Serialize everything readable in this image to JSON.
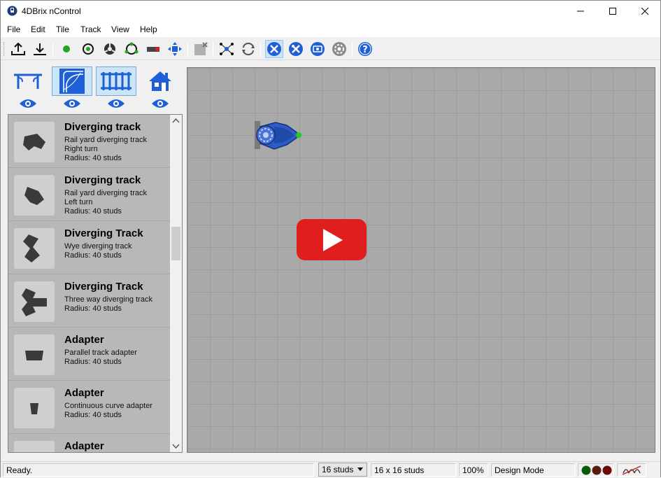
{
  "window": {
    "title": "4DBrix nControl"
  },
  "menu": {
    "items": [
      "File",
      "Edit",
      "Tile",
      "Track",
      "View",
      "Help"
    ]
  },
  "toolbar": {
    "icons": [
      "upload-icon",
      "download-icon",
      "green-dot-icon",
      "sensor-icon",
      "switch-icon",
      "loop-icon",
      "rail-icon",
      "move-icon",
      "delete-icon",
      "network-icon",
      "refresh-icon",
      "design-tools-icon",
      "tools-icon",
      "screen-icon",
      "gear-icon",
      "help-icon"
    ],
    "colors": {
      "accent": "#1f5fd6"
    }
  },
  "categories": [
    {
      "icon": "track-bench-icon",
      "active": false
    },
    {
      "icon": "curve-track-icon",
      "active": true
    },
    {
      "icon": "straight-track-icon",
      "active": true
    },
    {
      "icon": "house-icon",
      "active": false
    }
  ],
  "tiles": [
    {
      "title": "Diverging track",
      "lines": [
        "Rail yard diverging track",
        "Right turn",
        "Radius: 40 studs"
      ]
    },
    {
      "title": "Diverging track",
      "lines": [
        "Rail yard diverging track",
        "Left turn",
        "Radius: 40 studs"
      ]
    },
    {
      "title": "Diverging Track",
      "lines": [
        "Wye diverging track",
        "Radius: 40 studs"
      ]
    },
    {
      "title": "Diverging Track",
      "lines": [
        "Three way diverging track",
        "Radius: 40 studs"
      ]
    },
    {
      "title": "Adapter",
      "lines": [
        "Parallel track adapter",
        "Radius: 40 studs"
      ]
    },
    {
      "title": "Adapter",
      "lines": [
        "Continuous curve adapter",
        "Radius: 40 studs"
      ]
    },
    {
      "title": "Adapter",
      "lines": []
    }
  ],
  "status": {
    "message": "Ready.",
    "grid_size": "16 studs",
    "tile_size": "16 x 16 studs",
    "zoom": "100%",
    "mode": "Design Mode",
    "lights": [
      "#0a5a0a",
      "#5a1a0a",
      "#6a0a0a"
    ]
  }
}
